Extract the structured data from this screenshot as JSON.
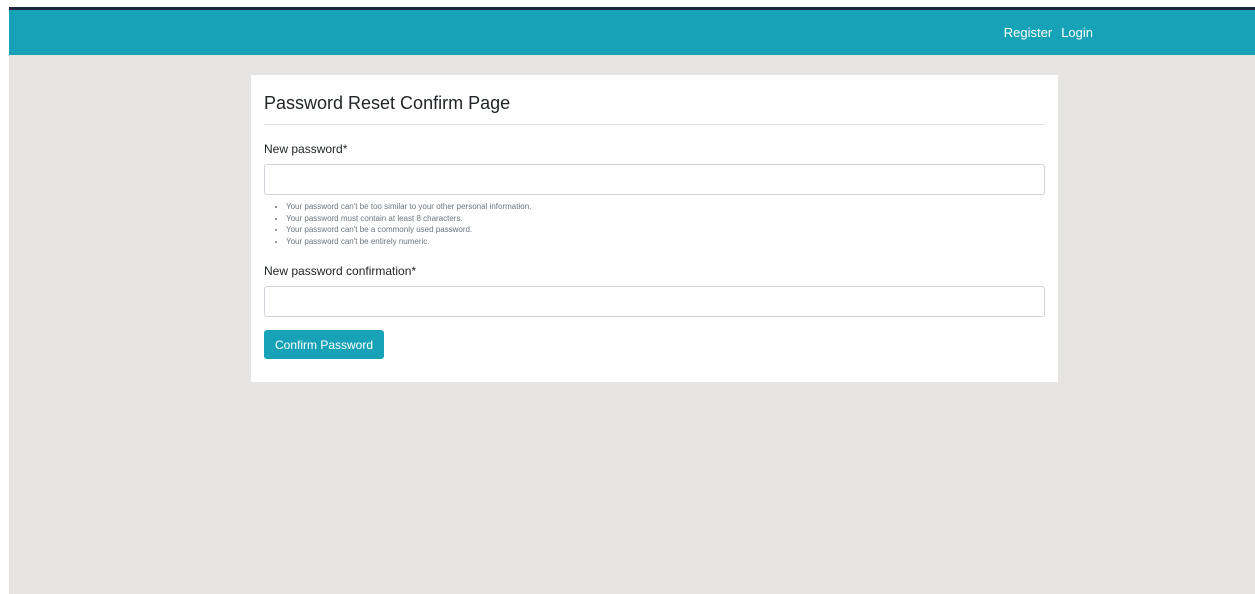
{
  "navbar": {
    "links": [
      {
        "label": "Register"
      },
      {
        "label": "Login"
      }
    ],
    "color": "#17a2b8"
  },
  "card": {
    "title": "Password Reset Confirm Page",
    "fields": {
      "new_password": {
        "label": "New password*",
        "value": "",
        "placeholder": ""
      },
      "confirm_password": {
        "label": "New password confirmation*",
        "value": "",
        "placeholder": ""
      }
    },
    "help_text": [
      "Your password can't be too similar to your other personal information.",
      "Your password must contain at least 8 characters.",
      "Your password can't be a commonly used password.",
      "Your password can't be entirely numeric."
    ],
    "submit_label": "Confirm Password"
  }
}
